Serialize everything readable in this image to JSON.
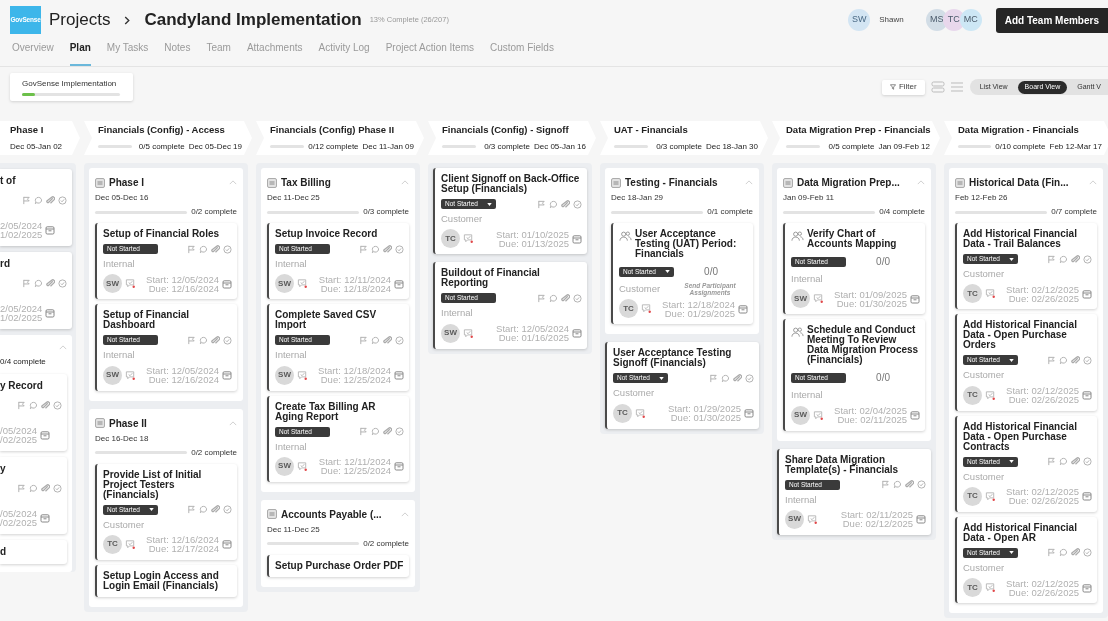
{
  "header": {
    "logo": "GovSense",
    "breadcrumb": "Projects",
    "title": "Candyland Implementation",
    "progress": "13% Complete (26/207)",
    "user": {
      "initials": "SW",
      "name": "Shawn",
      "color": "#d3e5f3"
    },
    "team": [
      {
        "initials": "MS",
        "color": "#d2dde6"
      },
      {
        "initials": "TC",
        "color": "#e8d7ec"
      },
      {
        "initials": "MC",
        "color": "#cde7f5"
      }
    ],
    "add_button": "Add Team Members"
  },
  "tabs": [
    {
      "label": "Overview",
      "selected": false
    },
    {
      "label": "Plan",
      "selected": true
    },
    {
      "label": "My Tasks",
      "selected": false
    },
    {
      "label": "Notes",
      "selected": false
    },
    {
      "label": "Team",
      "selected": false
    },
    {
      "label": "Attachments",
      "selected": false
    },
    {
      "label": "Activity Log",
      "selected": false
    },
    {
      "label": "Project Action Items",
      "selected": false
    },
    {
      "label": "Custom Fields",
      "selected": false
    }
  ],
  "toolbar": {
    "project_chip": {
      "label": "GovSense Implementation",
      "level": 0.13
    },
    "filter": "Filter",
    "views": [
      {
        "label": "List View",
        "selected": false
      },
      {
        "label": "Board View",
        "selected": true
      },
      {
        "label": "Gantt V",
        "selected": false
      }
    ]
  },
  "stages": [
    {
      "title": "Phase I",
      "dates": "Dec 05-Jan 02"
    },
    {
      "title": "Financials (Config) - Access",
      "complete": "0/5 complete",
      "dates": "Dec 05-Dec 19",
      "level": 0
    },
    {
      "title": "Financials (Config) Phase II",
      "complete": "0/12 complete",
      "dates": "Dec 11-Jan 09",
      "level": 0
    },
    {
      "title": "Financials (Config) - Signoff",
      "complete": "0/3 complete",
      "dates": "Dec 05-Jan 16",
      "level": 0
    },
    {
      "title": "UAT - Financials",
      "complete": "0/3 complete",
      "dates": "Dec 18-Jan 30",
      "level": 0
    },
    {
      "title": "Data Migration Prep - Financials",
      "complete": "0/5 complete",
      "dates": "Jan 09-Feb 12",
      "level": 0
    },
    {
      "title": "Data Migration - Financials",
      "complete": "0/10 complete",
      "dates": "Feb 12-Mar 17",
      "level": 0
    }
  ],
  "partial_column": {
    "items": [
      {
        "kind": "card",
        "title": "t of",
        "start": "2/05/2024",
        "due": "1/02/2025"
      },
      {
        "kind": "card",
        "title": "rd",
        "start": "2/05/2024",
        "due": "1/02/2025"
      },
      {
        "kind": "group",
        "progress": "0/4 complete",
        "children": [
          {
            "kind": "card",
            "title": "y Record",
            "start": "/05/2024",
            "due": "/02/2025"
          },
          {
            "kind": "card",
            "title": "y",
            "start": "/05/2024",
            "due": "/02/2025"
          },
          {
            "kind": "card",
            "title": "d"
          }
        ]
      }
    ]
  },
  "columns": [
    {
      "items": [
        {
          "kind": "group",
          "title": "Phase I",
          "dates": "Dec 05-Dec 16",
          "progress": "0/2 complete",
          "level": 0,
          "children": [
            {
              "kind": "task",
              "title": "Setup of Financial Roles",
              "status": "Not Started",
              "dropdown": false,
              "owner": "Internal",
              "avatar": "SW",
              "start": "Start: 12/05/2024",
              "due": "Due: 12/16/2024"
            },
            {
              "kind": "task",
              "title": "Setup of Financial Dashboard",
              "status": "Not Started",
              "dropdown": false,
              "owner": "Internal",
              "avatar": "SW",
              "start": "Start: 12/05/2024",
              "due": "Due: 12/16/2024"
            }
          ]
        },
        {
          "kind": "group",
          "title": "Phase II",
          "dates": "Dec 16-Dec 18",
          "progress": "0/2 complete",
          "level": 0,
          "children": [
            {
              "kind": "task",
              "title": "Provide List of Initial Project Testers (Financials)",
              "status": "Not Started",
              "dropdown": true,
              "owner": "Customer",
              "avatar": "TC",
              "start": "Start: 12/16/2024",
              "due": "Due: 12/17/2024"
            },
            {
              "kind": "task",
              "title": "Setup Login Access and Login Email (Financials)"
            }
          ]
        }
      ]
    },
    {
      "items": [
        {
          "kind": "group",
          "title": "Tax Billing",
          "dates": "Dec 11-Dec 25",
          "progress": "0/3 complete",
          "level": 0,
          "children": [
            {
              "kind": "task",
              "title": "Setup Invoice Record",
              "status": "Not Started",
              "dropdown": false,
              "owner": "Internal",
              "avatar": "SW",
              "start": "Start: 12/11/2024",
              "due": "Due: 12/18/2024"
            },
            {
              "kind": "task",
              "title": "Complete Saved CSV Import",
              "status": "Not Started",
              "dropdown": false,
              "owner": "Internal",
              "avatar": "SW",
              "start": "Start: 12/18/2024",
              "due": "Due: 12/25/2024"
            },
            {
              "kind": "task",
              "title": "Create Tax Billing AR Aging Report",
              "status": "Not Started",
              "dropdown": false,
              "owner": "Internal",
              "avatar": "SW",
              "start": "Start: 12/11/2024",
              "due": "Due: 12/25/2024"
            }
          ]
        },
        {
          "kind": "group",
          "title": "Accounts Payable (...",
          "dates": "Dec 11-Dec 25",
          "progress": "0/2 complete",
          "level": 0,
          "children": [
            {
              "kind": "task",
              "title": "Setup Purchase Order PDF"
            }
          ]
        }
      ]
    },
    {
      "items": [
        {
          "kind": "task",
          "title": "Client Signoff on Back-Office Setup (Financials)",
          "status": "Not Started",
          "dropdown": true,
          "owner": "Customer",
          "avatar": "TC",
          "start": "Start: 01/10/2025",
          "due": "Due: 01/13/2025"
        },
        {
          "kind": "task",
          "title": "Buildout of Financial Reporting",
          "status": "Not Started",
          "dropdown": false,
          "owner": "Internal",
          "avatar": "SW",
          "start": "Start: 12/05/2024",
          "due": "Due: 01/16/2025"
        }
      ]
    },
    {
      "items": [
        {
          "kind": "group",
          "title": "Testing - Financials",
          "dates": "Dec 18-Jan 29",
          "progress": "0/1 complete",
          "level": 0,
          "children": [
            {
              "kind": "meeting",
              "title": "User Acceptance Testing (UAT) Period: Financials",
              "status": "Not Started",
              "dropdown": true,
              "counter": "0/0",
              "owner": "Customer",
              "note": "Send Participant Assignments",
              "avatar": "TC",
              "start": "Start: 12/18/2024",
              "due": "Due: 01/29/2025"
            }
          ]
        },
        {
          "kind": "task",
          "title": "User Acceptance Testing Signoff (Financials)",
          "status": "Not Started",
          "dropdown": true,
          "owner": "Customer",
          "avatar": "TC",
          "start": "Start: 01/29/2025",
          "due": "Due: 01/30/2025"
        }
      ]
    },
    {
      "items": [
        {
          "kind": "group",
          "title": "Data Migration Prep...",
          "dates": "Jan 09-Feb 11",
          "progress": "0/4 complete",
          "level": 0,
          "children": [
            {
              "kind": "meeting",
              "title": "Verify Chart of Accounts Mapping",
              "status": "Not Started",
              "dropdown": false,
              "counter": "0/0",
              "owner": "Internal",
              "avatar": "SW",
              "start": "Start: 01/09/2025",
              "due": "Due: 01/30/2025"
            },
            {
              "kind": "meeting",
              "title": "Schedule and Conduct Meeting To Review Data Migration Process (Financials)",
              "status": "Not Started",
              "dropdown": false,
              "counter": "0/0",
              "owner": "Internal",
              "avatar": "SW",
              "start": "Start: 02/04/2025",
              "due": "Due: 02/11/2025"
            }
          ]
        },
        {
          "kind": "task",
          "title": "Share Data Migration Template(s) - Financials",
          "status": "Not Started",
          "dropdown": false,
          "owner": "Internal",
          "avatar": "SW",
          "start": "Start: 02/11/2025",
          "due": "Due: 02/12/2025"
        }
      ]
    },
    {
      "items": [
        {
          "kind": "group",
          "title": "Historical Data (Fin...",
          "dates": "Feb 12-Feb 26",
          "progress": "0/7 complete",
          "level": 0,
          "children": [
            {
              "kind": "task",
              "title": "Add Historical Financial Data - Trail Balances",
              "status": "Not Started",
              "dropdown": true,
              "owner": "Customer",
              "avatar": "TC",
              "start": "Start: 02/12/2025",
              "due": "Due: 02/26/2025"
            },
            {
              "kind": "task",
              "title": "Add Historical Financial Data - Open Purchase Orders",
              "status": "Not Started",
              "dropdown": true,
              "owner": "Customer",
              "avatar": "TC",
              "start": "Start: 02/12/2025",
              "due": "Due: 02/26/2025"
            },
            {
              "kind": "task",
              "title": "Add Historical Financial Data - Open Purchase Contracts",
              "status": "Not Started",
              "dropdown": true,
              "owner": "Customer",
              "avatar": "TC",
              "start": "Start: 02/12/2025",
              "due": "Due: 02/26/2025"
            },
            {
              "kind": "task",
              "title": "Add Historical Financial Data - Open AR",
              "status": "Not Started",
              "dropdown": true,
              "owner": "Customer",
              "avatar": "TC",
              "start": "Start: 02/12/2025",
              "due": "Due: 02/26/2025"
            }
          ]
        }
      ]
    }
  ]
}
